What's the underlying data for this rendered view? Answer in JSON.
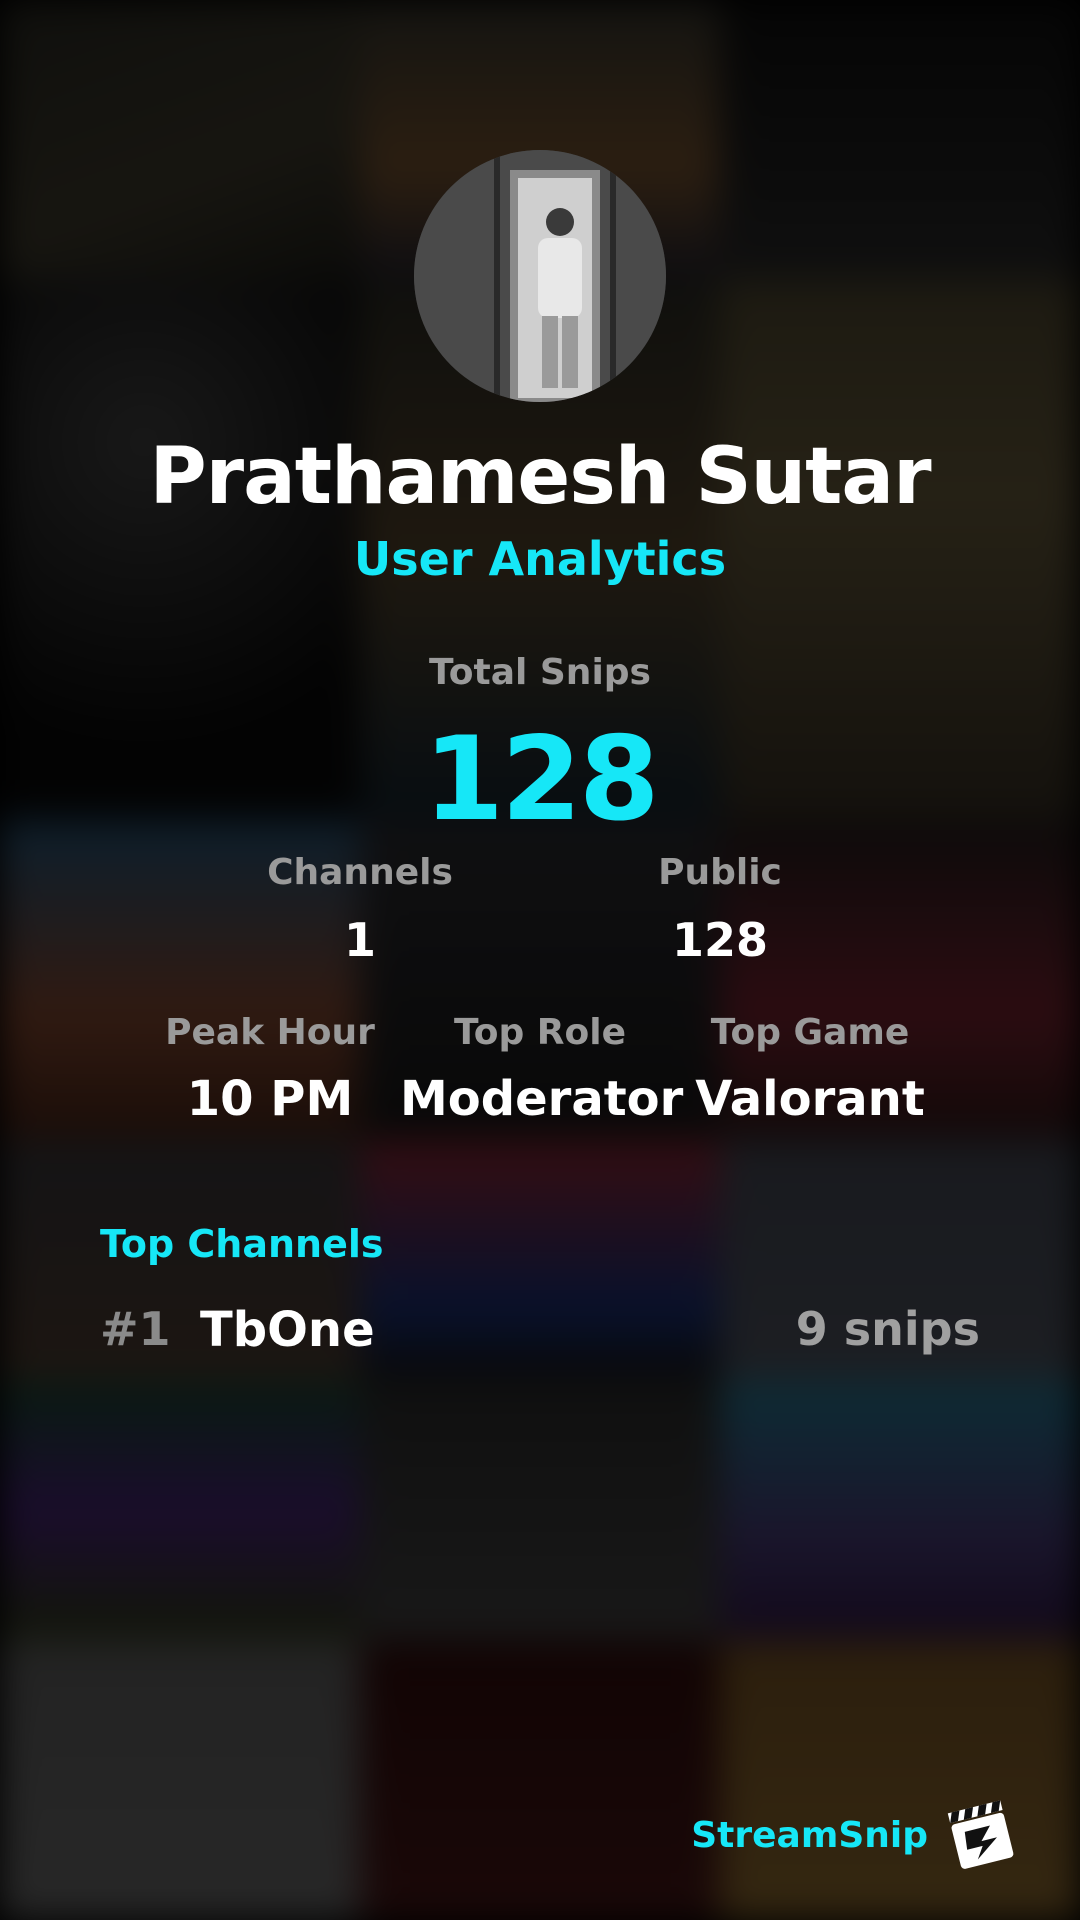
{
  "profile": {
    "name": "Prathamesh Sutar",
    "subtitle": "User Analytics"
  },
  "stats": {
    "total_label": "Total Snips",
    "total_value": "128",
    "channels_label": "Channels",
    "channels_value": "1",
    "public_label": "Public",
    "public_value": "128",
    "peak_label": "Peak Hour",
    "peak_value": "10 PM",
    "role_label": "Top Role",
    "role_value": "Moderator",
    "game_label": "Top Game",
    "game_value": "Valorant"
  },
  "top_channels": {
    "title": "Top Channels",
    "items": [
      {
        "rank": "#1",
        "name": "TbOne",
        "snips": "9 snips"
      }
    ]
  },
  "brand": {
    "name": "StreamSnip",
    "logo_icon": "clapperboard-icon"
  },
  "colors": {
    "accent": "#16e7f7",
    "text": "#ffffff",
    "muted": "#9a9a9a"
  }
}
